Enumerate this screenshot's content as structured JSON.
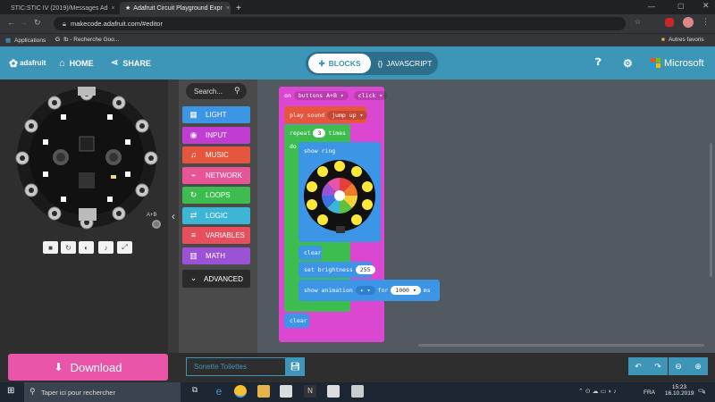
{
  "browser": {
    "tabs": [
      {
        "title": "STIC:STIC IV (2019)/Messages Ad",
        "close": "×"
      },
      {
        "title": "Adafruit Circuit Playground Expr",
        "close": "×"
      }
    ],
    "new_tab": "+",
    "url": "makecode.adafruit.com/#editor",
    "bookmarks": [
      {
        "label": "Applications"
      },
      {
        "label": "fb - Recherche Goo..."
      }
    ],
    "other_bookmarks": "Autres favoris"
  },
  "header": {
    "brand": "adafruit",
    "home": "HOME",
    "share": "SHARE",
    "blocks": "BLOCKS",
    "javascript": "JAVASCRIPT",
    "microsoft": "Microsoft"
  },
  "simulator": {
    "board_labels": {
      "a_b": "A+B"
    }
  },
  "toolbox": {
    "search_placeholder": "Search...",
    "categories": [
      {
        "label": "LIGHT",
        "color": "#3d95e6",
        "icon": "grid-icon",
        "glyph": "▦"
      },
      {
        "label": "INPUT",
        "color": "#c13dd1",
        "icon": "target-icon",
        "glyph": "◉"
      },
      {
        "label": "MUSIC",
        "color": "#e6553d",
        "icon": "headphones-icon",
        "glyph": "♫"
      },
      {
        "label": "NETWORK",
        "color": "#e85597",
        "icon": "network-icon",
        "glyph": "⌁"
      },
      {
        "label": "LOOPS",
        "color": "#3dbd4f",
        "icon": "refresh-icon",
        "glyph": "↻"
      },
      {
        "label": "LOGIC",
        "color": "#3db6d6",
        "icon": "shuffle-icon",
        "glyph": "⇄"
      },
      {
        "label": "VARIABLES",
        "color": "#e84f5c",
        "icon": "list-icon",
        "glyph": "≡"
      },
      {
        "label": "MATH",
        "color": "#9b52d4",
        "icon": "calculator-icon",
        "glyph": "▥"
      }
    ],
    "advanced": "ADVANCED"
  },
  "blocks": {
    "on": "on",
    "button_choice": "buttons A+B",
    "gesture": "click",
    "play_sound": "play sound",
    "sound": "jump up",
    "repeat": "repeat",
    "repeat_count": "3",
    "times": "times",
    "do": "do",
    "show_ring": "show ring",
    "clear": "clear",
    "set_brightness": "set brightness",
    "brightness": "255",
    "show_animation": "show animation",
    "for": "for",
    "duration": "1000",
    "ms": "ms",
    "clear2": "clear"
  },
  "bottom": {
    "download": "Download",
    "project_name": "Sonette Toilettes"
  },
  "taskbar": {
    "search_placeholder": "Taper ici pour rechercher",
    "lang": "FRA",
    "time": "15:23",
    "date": "16.10.2019",
    "notification_count": "4"
  }
}
